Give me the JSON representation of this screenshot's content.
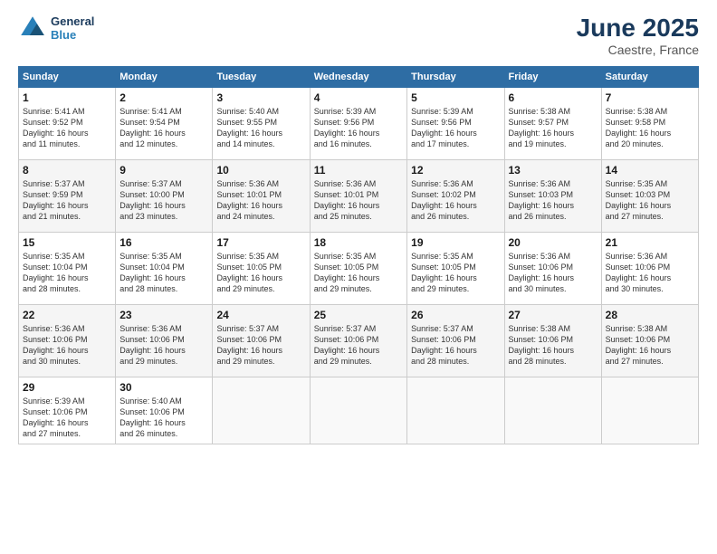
{
  "logo": {
    "line1": "General",
    "line2": "Blue"
  },
  "title": "June 2025",
  "location": "Caestre, France",
  "headers": [
    "Sunday",
    "Monday",
    "Tuesday",
    "Wednesday",
    "Thursday",
    "Friday",
    "Saturday"
  ],
  "weeks": [
    [
      {
        "day": "1",
        "info": "Sunrise: 5:41 AM\nSunset: 9:52 PM\nDaylight: 16 hours\nand 11 minutes."
      },
      {
        "day": "2",
        "info": "Sunrise: 5:41 AM\nSunset: 9:54 PM\nDaylight: 16 hours\nand 12 minutes."
      },
      {
        "day": "3",
        "info": "Sunrise: 5:40 AM\nSunset: 9:55 PM\nDaylight: 16 hours\nand 14 minutes."
      },
      {
        "day": "4",
        "info": "Sunrise: 5:39 AM\nSunset: 9:56 PM\nDaylight: 16 hours\nand 16 minutes."
      },
      {
        "day": "5",
        "info": "Sunrise: 5:39 AM\nSunset: 9:56 PM\nDaylight: 16 hours\nand 17 minutes."
      },
      {
        "day": "6",
        "info": "Sunrise: 5:38 AM\nSunset: 9:57 PM\nDaylight: 16 hours\nand 19 minutes."
      },
      {
        "day": "7",
        "info": "Sunrise: 5:38 AM\nSunset: 9:58 PM\nDaylight: 16 hours\nand 20 minutes."
      }
    ],
    [
      {
        "day": "8",
        "info": "Sunrise: 5:37 AM\nSunset: 9:59 PM\nDaylight: 16 hours\nand 21 minutes."
      },
      {
        "day": "9",
        "info": "Sunrise: 5:37 AM\nSunset: 10:00 PM\nDaylight: 16 hours\nand 23 minutes."
      },
      {
        "day": "10",
        "info": "Sunrise: 5:36 AM\nSunset: 10:01 PM\nDaylight: 16 hours\nand 24 minutes."
      },
      {
        "day": "11",
        "info": "Sunrise: 5:36 AM\nSunset: 10:01 PM\nDaylight: 16 hours\nand 25 minutes."
      },
      {
        "day": "12",
        "info": "Sunrise: 5:36 AM\nSunset: 10:02 PM\nDaylight: 16 hours\nand 26 minutes."
      },
      {
        "day": "13",
        "info": "Sunrise: 5:36 AM\nSunset: 10:03 PM\nDaylight: 16 hours\nand 26 minutes."
      },
      {
        "day": "14",
        "info": "Sunrise: 5:35 AM\nSunset: 10:03 PM\nDaylight: 16 hours\nand 27 minutes."
      }
    ],
    [
      {
        "day": "15",
        "info": "Sunrise: 5:35 AM\nSunset: 10:04 PM\nDaylight: 16 hours\nand 28 minutes."
      },
      {
        "day": "16",
        "info": "Sunrise: 5:35 AM\nSunset: 10:04 PM\nDaylight: 16 hours\nand 28 minutes."
      },
      {
        "day": "17",
        "info": "Sunrise: 5:35 AM\nSunset: 10:05 PM\nDaylight: 16 hours\nand 29 minutes."
      },
      {
        "day": "18",
        "info": "Sunrise: 5:35 AM\nSunset: 10:05 PM\nDaylight: 16 hours\nand 29 minutes."
      },
      {
        "day": "19",
        "info": "Sunrise: 5:35 AM\nSunset: 10:05 PM\nDaylight: 16 hours\nand 29 minutes."
      },
      {
        "day": "20",
        "info": "Sunrise: 5:36 AM\nSunset: 10:06 PM\nDaylight: 16 hours\nand 30 minutes."
      },
      {
        "day": "21",
        "info": "Sunrise: 5:36 AM\nSunset: 10:06 PM\nDaylight: 16 hours\nand 30 minutes."
      }
    ],
    [
      {
        "day": "22",
        "info": "Sunrise: 5:36 AM\nSunset: 10:06 PM\nDaylight: 16 hours\nand 30 minutes."
      },
      {
        "day": "23",
        "info": "Sunrise: 5:36 AM\nSunset: 10:06 PM\nDaylight: 16 hours\nand 29 minutes."
      },
      {
        "day": "24",
        "info": "Sunrise: 5:37 AM\nSunset: 10:06 PM\nDaylight: 16 hours\nand 29 minutes."
      },
      {
        "day": "25",
        "info": "Sunrise: 5:37 AM\nSunset: 10:06 PM\nDaylight: 16 hours\nand 29 minutes."
      },
      {
        "day": "26",
        "info": "Sunrise: 5:37 AM\nSunset: 10:06 PM\nDaylight: 16 hours\nand 28 minutes."
      },
      {
        "day": "27",
        "info": "Sunrise: 5:38 AM\nSunset: 10:06 PM\nDaylight: 16 hours\nand 28 minutes."
      },
      {
        "day": "28",
        "info": "Sunrise: 5:38 AM\nSunset: 10:06 PM\nDaylight: 16 hours\nand 27 minutes."
      }
    ],
    [
      {
        "day": "29",
        "info": "Sunrise: 5:39 AM\nSunset: 10:06 PM\nDaylight: 16 hours\nand 27 minutes."
      },
      {
        "day": "30",
        "info": "Sunrise: 5:40 AM\nSunset: 10:06 PM\nDaylight: 16 hours\nand 26 minutes."
      },
      null,
      null,
      null,
      null,
      null
    ]
  ]
}
